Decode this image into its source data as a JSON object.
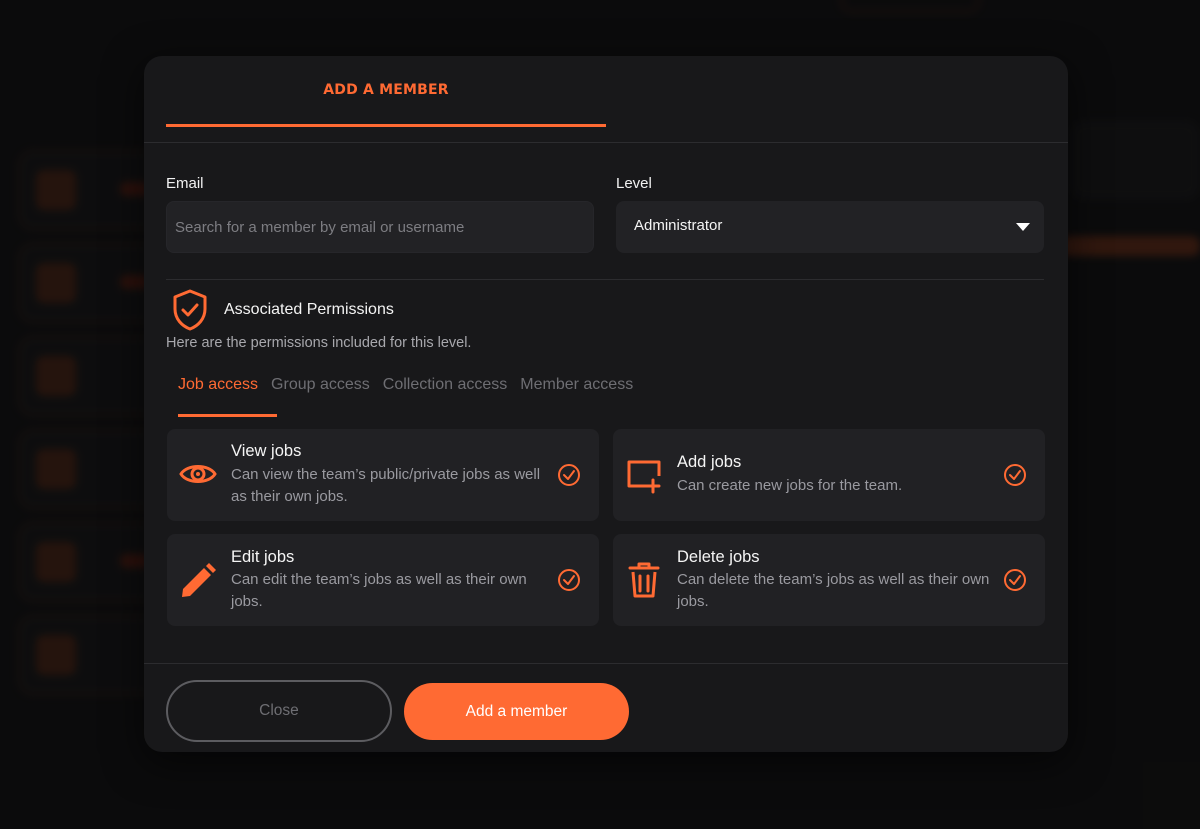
{
  "modal": {
    "title": "ADD A MEMBER",
    "email": {
      "label": "Email",
      "placeholder": "Search for a member by email or username",
      "value": ""
    },
    "level": {
      "label": "Level",
      "selected": "Administrator"
    },
    "permissions": {
      "title": "Associated Permissions",
      "subtitle": "Here are the permissions included for this level.",
      "tabs": [
        {
          "label": "Job access",
          "active": true
        },
        {
          "label": "Group access",
          "active": false
        },
        {
          "label": "Collection access",
          "active": false
        },
        {
          "label": "Member access",
          "active": false
        }
      ],
      "items": [
        {
          "icon": "eye-icon",
          "name": "View jobs",
          "desc": "Can view the team’s public/private jobs as well as their own jobs.",
          "granted": true
        },
        {
          "icon": "add-window-icon",
          "name": "Add jobs",
          "desc": "Can create new jobs for the team.",
          "granted": true
        },
        {
          "icon": "pencil-icon",
          "name": "Edit jobs",
          "desc": "Can edit the team’s jobs as well as their own jobs.",
          "granted": true
        },
        {
          "icon": "trash-icon",
          "name": "Delete jobs",
          "desc": "Can delete the team’s jobs as well as their own jobs.",
          "granted": true
        }
      ]
    },
    "buttons": {
      "close": "Close",
      "add": "Add a member"
    }
  },
  "colors": {
    "accent": "#ff6a33",
    "modal_bg": "#18181a",
    "card_bg": "#212124"
  }
}
